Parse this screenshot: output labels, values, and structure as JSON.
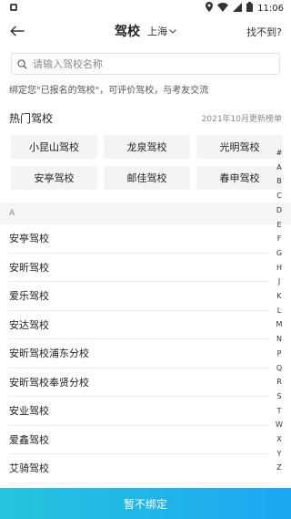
{
  "status": {
    "time": "11:06"
  },
  "nav": {
    "title": "驾校",
    "city": "上海",
    "not_found": "找不到?"
  },
  "search": {
    "placeholder": "请输入驾校名称"
  },
  "hint": "绑定您\"已报名的驾校\"，可评价驾校，与考友交流",
  "hot": {
    "title": "热门驾校",
    "update_text": "2021年10月更新榜单",
    "items": [
      "小昆山驾校",
      "龙泉驾校",
      "光明驾校",
      "安亭驾校",
      "邮佳驾校",
      "春申驾校"
    ]
  },
  "section_letter": "A",
  "schools": [
    "安亭驾校",
    "安昕驾校",
    "爱乐驾校",
    "安达驾校",
    "安昕驾校浦东分校",
    "安昕驾校奉贤分校",
    "安业驾校",
    "爱鑫驾校",
    "艾骑驾校"
  ],
  "alphabet": [
    "#",
    "A",
    "B",
    "C",
    "D",
    "E",
    "F",
    "G",
    "H",
    "J",
    "K",
    "L",
    "M",
    "N",
    "P",
    "Q",
    "R",
    "S",
    "T",
    "W",
    "X",
    "Y",
    "Z"
  ],
  "bottom_button": "暂不绑定",
  "colors": {
    "accent_start": "#27c3dd",
    "accent_end": "#1ba7f2"
  }
}
